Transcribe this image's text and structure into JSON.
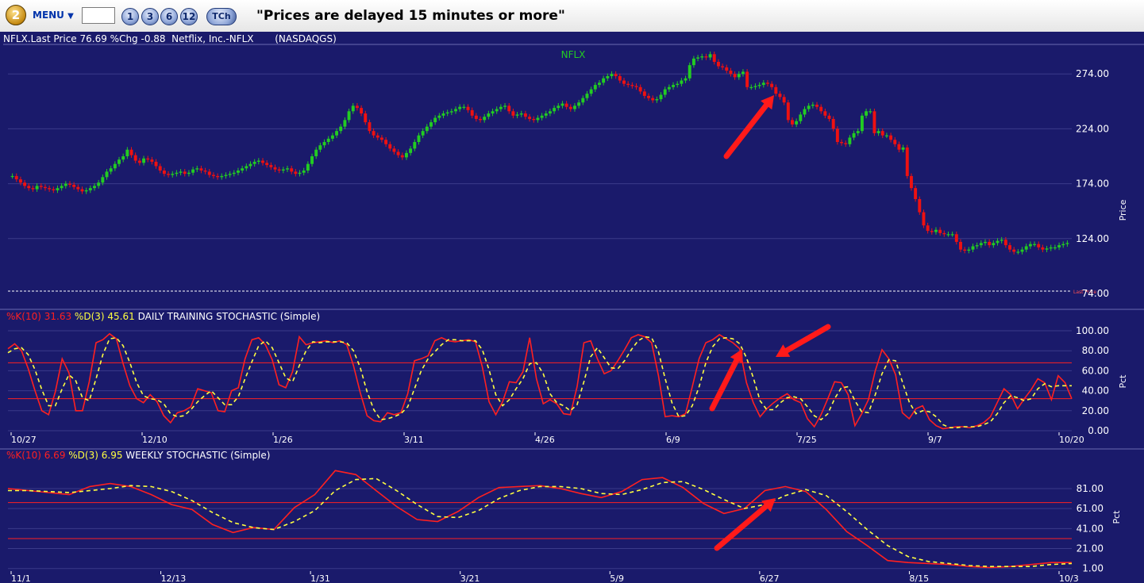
{
  "toolbar": {
    "logo_number": "2",
    "menu_label": "MENU",
    "symbol_value": "",
    "buttons": [
      "1",
      "3",
      "6",
      "12"
    ],
    "tch_label": "TCh",
    "notice": "\"Prices are delayed 15 minutes or more\""
  },
  "quote": {
    "line": "NFLX.Last Price 76.69 %Chg -0.88  Netflix, Inc.-NFLX       (NASDAQGS)"
  },
  "colors": {
    "background": "#1a1a6b",
    "up": "#22cc22",
    "down": "#ee1111",
    "k_line": "#ff2020",
    "d_line": "#ffff40",
    "arrow": "#ff1a1a",
    "grid": "#3a3a8a"
  },
  "chart_data": [
    {
      "type": "candlestick",
      "title": "NFLX",
      "ylabel": "Price",
      "ylim": [
        74,
        298
      ],
      "yticks": [
        "274.00",
        "224.00",
        "174.00",
        "124.00",
        "74.00"
      ],
      "last_price_marker": "Last Price",
      "closes": [
        181,
        178,
        175,
        172,
        170,
        169,
        172,
        171,
        170,
        169,
        168,
        170,
        172,
        174,
        173,
        171,
        169,
        167,
        168,
        170,
        172,
        175,
        180,
        185,
        188,
        192,
        196,
        199,
        205,
        200,
        195,
        193,
        197,
        196,
        194,
        190,
        186,
        183,
        182,
        183,
        184,
        185,
        183,
        184,
        187,
        188,
        186,
        185,
        182,
        181,
        180,
        181,
        182,
        183,
        184,
        186,
        188,
        190,
        192,
        194,
        195,
        193,
        191,
        189,
        187,
        186,
        187,
        188,
        185,
        183,
        184,
        186,
        192,
        199,
        205,
        209,
        212,
        215,
        218,
        222,
        226,
        232,
        240,
        245,
        243,
        238,
        230,
        222,
        218,
        216,
        214,
        210,
        206,
        203,
        200,
        198,
        202,
        206,
        212,
        218,
        222,
        226,
        230,
        234,
        236,
        238,
        239,
        240,
        242,
        244,
        244,
        241,
        236,
        233,
        232,
        235,
        238,
        240,
        242,
        244,
        245,
        240,
        236,
        237,
        238,
        235,
        233,
        232,
        234,
        236,
        238,
        240,
        243,
        245,
        247,
        244,
        242,
        245,
        248,
        252,
        256,
        260,
        264,
        266,
        270,
        272,
        274,
        272,
        268,
        265,
        264,
        263,
        262,
        258,
        254,
        252,
        250,
        251,
        255,
        260,
        262,
        264,
        265,
        268,
        270,
        282,
        288,
        289,
        290,
        289,
        292,
        285,
        281,
        280,
        277,
        274,
        271,
        274,
        276,
        262,
        262,
        263,
        264,
        266,
        265,
        262,
        256,
        253,
        248,
        232,
        228,
        231,
        237,
        242,
        245,
        246,
        244,
        240,
        236,
        233,
        224,
        212,
        211,
        210,
        216,
        220,
        222,
        236,
        240,
        240,
        220,
        222,
        218,
        218,
        214,
        210,
        205,
        207,
        181,
        170,
        160,
        148,
        136,
        131,
        130,
        132,
        129,
        128,
        128,
        128,
        121,
        114,
        113,
        114,
        117,
        118,
        120,
        121,
        118,
        120,
        122,
        123,
        118,
        114,
        112,
        112,
        114,
        117,
        119,
        119,
        116,
        114,
        115,
        116,
        116,
        118,
        119,
        120
      ]
    },
    {
      "type": "line",
      "title": "DAILY TRAINING STOCHASTIC (Simple)",
      "ylabel": "Pct",
      "ylim": [
        0,
        100
      ],
      "yticks": [
        "100.00",
        "80.00",
        "60.00",
        "40.00",
        "20.00",
        "0.00"
      ],
      "x_labels": [
        "10/27",
        "12/10",
        "1/26",
        "3/11",
        "4/26",
        "6/9",
        "7/25",
        "9/7",
        "10/20"
      ],
      "overbought": 68,
      "oversold": 32,
      "series": [
        {
          "name": "%K(10)",
          "last_value": "31.63",
          "values": [
            82,
            87,
            80,
            62,
            40,
            20,
            16,
            39,
            72,
            58,
            20,
            20,
            49,
            88,
            91,
            97,
            92,
            67,
            45,
            32,
            28,
            36,
            29,
            15,
            8,
            18,
            20,
            24,
            42,
            40,
            38,
            20,
            19,
            40,
            43,
            72,
            91,
            93,
            86,
            71,
            46,
            43,
            59,
            94,
            86,
            88,
            89,
            90,
            88,
            90,
            86,
            65,
            38,
            15,
            10,
            9,
            18,
            16,
            18,
            37,
            70,
            72,
            75,
            90,
            93,
            90,
            89,
            90,
            91,
            89,
            64,
            29,
            16,
            29,
            49,
            48,
            59,
            93,
            52,
            27,
            31,
            27,
            17,
            16,
            44,
            88,
            90,
            72,
            57,
            60,
            70,
            81,
            93,
            96,
            94,
            88,
            55,
            14,
            15,
            14,
            17,
            44,
            72,
            88,
            91,
            96,
            92,
            88,
            82,
            48,
            28,
            14,
            22,
            28,
            33,
            37,
            31,
            28,
            12,
            4,
            16,
            32,
            49,
            48,
            36,
            5,
            17,
            31,
            60,
            81,
            72,
            56,
            18,
            12,
            22,
            25,
            11,
            5,
            2,
            3,
            4,
            4,
            3,
            5,
            8,
            14,
            28,
            42,
            36,
            22,
            32,
            41,
            52,
            48,
            31,
            55,
            48,
            32
          ]
        },
        {
          "name": "%D(3)",
          "last_value": "45.61",
          "values": [
            78,
            82,
            83,
            76,
            61,
            41,
            25,
            25,
            42,
            56,
            50,
            33,
            30,
            52,
            76,
            92,
            93,
            85,
            68,
            48,
            35,
            32,
            31,
            27,
            17,
            14,
            15,
            21,
            29,
            35,
            40,
            33,
            26,
            26,
            34,
            52,
            69,
            85,
            90,
            83,
            68,
            53,
            49,
            65,
            80,
            89,
            88,
            89,
            89,
            89,
            88,
            80,
            63,
            39,
            21,
            11,
            12,
            14,
            17,
            24,
            42,
            60,
            72,
            79,
            86,
            91,
            91,
            90,
            90,
            90,
            81,
            61,
            36,
            25,
            31,
            42,
            52,
            67,
            68,
            57,
            37,
            28,
            25,
            20,
            26,
            49,
            74,
            83,
            73,
            63,
            62,
            70,
            81,
            90,
            94,
            93,
            79,
            52,
            28,
            14,
            15,
            25,
            44,
            68,
            84,
            92,
            93,
            92,
            87,
            73,
            53,
            30,
            21,
            21,
            28,
            33,
            34,
            32,
            24,
            15,
            11,
            17,
            32,
            43,
            44,
            30,
            19,
            18,
            36,
            57,
            71,
            70,
            49,
            29,
            17,
            20,
            19,
            14,
            6,
            3,
            3,
            4,
            4,
            4,
            6,
            9,
            17,
            28,
            35,
            33,
            30,
            32,
            42,
            47,
            44,
            45,
            45,
            45
          ]
        }
      ]
    },
    {
      "type": "line",
      "title": "WEEKLY STOCHASTIC (Simple)",
      "ylabel": "Pct",
      "ylim": [
        0,
        100
      ],
      "yticks": [
        "81.00",
        "61.00",
        "41.00",
        "21.00",
        "1.00"
      ],
      "x_labels": [
        "11/1",
        "12/13",
        "1/31",
        "3/21",
        "5/9",
        "6/27",
        "8/15",
        "10/3"
      ],
      "overbought": 67,
      "oversold": 31,
      "series": [
        {
          "name": "%K(10)",
          "last_value": "6.69",
          "values": [
            81,
            79,
            77,
            75,
            83,
            86,
            83,
            75,
            65,
            60,
            45,
            37,
            42,
            40,
            62,
            75,
            99,
            95,
            79,
            63,
            50,
            48,
            58,
            72,
            82,
            83,
            84,
            81,
            76,
            72,
            78,
            90,
            92,
            82,
            66,
            56,
            61,
            79,
            83,
            78,
            60,
            38,
            24,
            9,
            7,
            6,
            5,
            3,
            2,
            3,
            5,
            7,
            7
          ]
        },
        {
          "name": "%D(3)",
          "last_value": "6.95",
          "values": [
            79,
            79,
            78,
            77,
            79,
            81,
            84,
            83,
            78,
            69,
            57,
            47,
            42,
            40,
            48,
            59,
            79,
            90,
            91,
            79,
            65,
            53,
            52,
            59,
            71,
            79,
            83,
            83,
            81,
            76,
            75,
            80,
            87,
            88,
            80,
            70,
            61,
            65,
            74,
            80,
            74,
            58,
            40,
            24,
            13,
            8,
            6,
            4,
            3,
            3,
            3,
            5,
            6
          ]
        }
      ]
    }
  ]
}
